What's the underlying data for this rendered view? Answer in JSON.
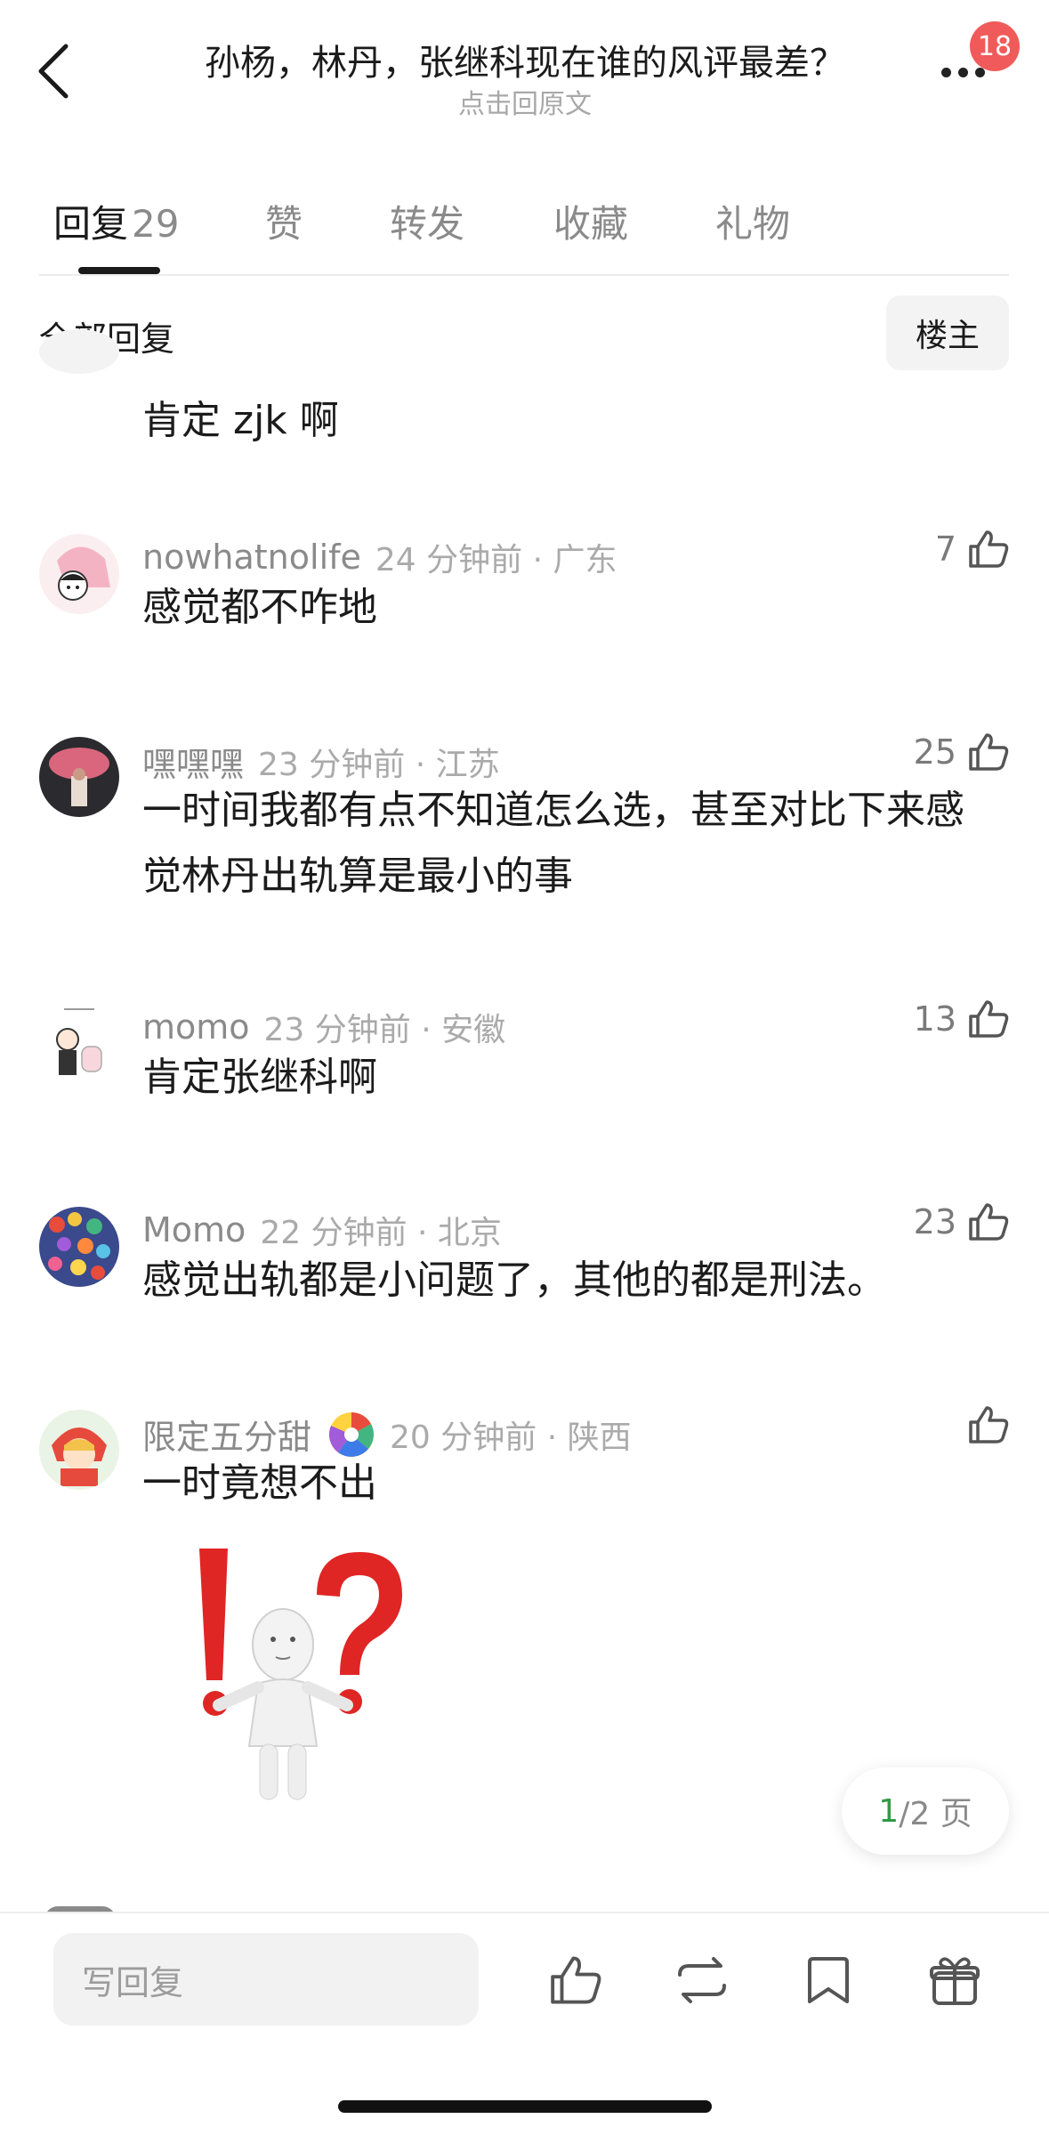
{
  "header": {
    "title": "孙杨，林丹，张继科现在谁的风评最差？",
    "subtitle": "点击回原文",
    "badge": "18"
  },
  "tabs": [
    {
      "label": "回复",
      "count": "29"
    },
    {
      "label": "赞"
    },
    {
      "label": "转发"
    },
    {
      "label": "收藏"
    },
    {
      "label": "礼物"
    }
  ],
  "section": {
    "title": "全部回复",
    "op_label": "楼主"
  },
  "comments": [
    {
      "user": "",
      "time": "",
      "content": "肯定 zjk 啊",
      "likes": ""
    },
    {
      "user": "nowhatnolife",
      "time": "24 分钟前 · 广东",
      "content": "感觉都不咋地",
      "likes": "7"
    },
    {
      "user": "嘿嘿嘿",
      "time": "23 分钟前 · 江苏",
      "content": "一时间我都有点不知道怎么选，甚至对比下来感觉林丹出轨算是最小的事",
      "likes": "25"
    },
    {
      "user": "momo",
      "time": "23 分钟前 · 安徽",
      "content": "肯定张继科啊",
      "likes": "13"
    },
    {
      "user": "Momo",
      "time": "22 分钟前 · 北京",
      "content": "感觉出轨都是小问题了，其他的都是刑法。",
      "likes": "23"
    },
    {
      "user": "限定五分甜",
      "time": "20 分钟前 · 陕西",
      "content": "一时竟想不出",
      "likes": ""
    }
  ],
  "pagination": {
    "current": "1",
    "rest": "/2 页"
  },
  "bottom_bar": {
    "reply_placeholder": "写回复"
  },
  "colors": {
    "accent_green": "#2f9a45",
    "badge_red": "#f15a5a",
    "text_gray": "#8a8a8a"
  },
  "icons": [
    "back-arrow-icon",
    "more-dots-icon",
    "thumbs-up-icon",
    "repost-icon",
    "bookmark-icon",
    "gift-icon"
  ]
}
